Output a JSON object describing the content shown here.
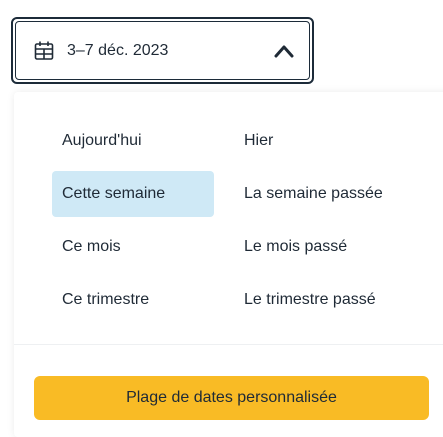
{
  "date_field": {
    "value": "3–7 déc. 2023",
    "calendar_icon": "calendar-icon",
    "toggle_icon": "chevron-up-icon"
  },
  "presets": {
    "left": [
      {
        "label": "Aujourd'hui",
        "selected": false
      },
      {
        "label": "Cette semaine",
        "selected": true
      },
      {
        "label": "Ce mois",
        "selected": false
      },
      {
        "label": "Ce trimestre",
        "selected": false
      }
    ],
    "right": [
      {
        "label": "Hier",
        "selected": false
      },
      {
        "label": "La semaine passée",
        "selected": false
      },
      {
        "label": "Le mois passé",
        "selected": false
      },
      {
        "label": "Le trimestre passé",
        "selected": false
      }
    ]
  },
  "custom_range_button": "Plage de dates personnalisée",
  "colors": {
    "selected_bg": "#cfe9f6",
    "button_bg": "#f9bb25",
    "field_border": "#1c2b39"
  }
}
